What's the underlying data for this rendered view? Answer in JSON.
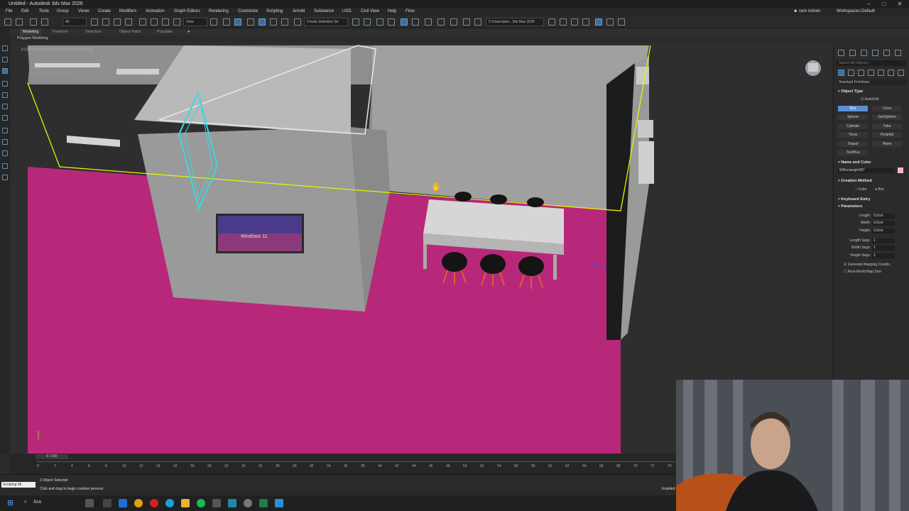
{
  "window": {
    "title": "Untitled - Autodesk 3ds Max 2026",
    "minimize": "–",
    "maximize": "□",
    "close": "✕"
  },
  "menus": [
    "File",
    "Edit",
    "Tools",
    "Group",
    "Views",
    "Create",
    "Modifiers",
    "Animation",
    "Graph Editors",
    "Rendering",
    "Customize",
    "Scripting",
    "Arnold",
    "Substance",
    "USD",
    "Civil View",
    "Help",
    "Flow"
  ],
  "user": {
    "name": "cem isimen",
    "workspaces_label": "Workspaces:",
    "workspace": "Default"
  },
  "toolbar": {
    "filter": "All",
    "view": "View",
    "selection_set": "Create Selection Se",
    "path": "C:\\Users\\pen...3ds Max 2026"
  },
  "ribbon": {
    "tabs": [
      "Modeling",
      "Freeform",
      "Selection",
      "Object Paint",
      "Populate"
    ],
    "active": "Modeling",
    "subtab": "Polygon Modeling"
  },
  "viewport": {
    "label": "[+] [Perspective] [Standard] [Default Shading]",
    "tv_text": "Windows 11"
  },
  "command_panel": {
    "search_placeholder": "Search All Objects...",
    "category": "Standard Primitives",
    "object_type": {
      "title": "Object Type",
      "autogrid": "AutoGrid",
      "buttons": [
        "Box",
        "Cone",
        "Sphere",
        "GeoSphere",
        "Cylinder",
        "Tube",
        "Torus",
        "Pyramid",
        "Teapot",
        "Plane",
        "TextPlus"
      ],
      "selected": "Box"
    },
    "name_and_color": {
      "title": "Name and Color",
      "name": "WRectangle087",
      "color": "#f2b8c6"
    },
    "creation_method": {
      "title": "Creation Method",
      "options": [
        "Cube",
        "Box"
      ],
      "selected": "Box"
    },
    "keyboard_entry": {
      "title": "Keyboard Entry"
    },
    "parameters": {
      "title": "Parameters",
      "fields": [
        {
          "label": "Length:",
          "value": "0,0cm"
        },
        {
          "label": "Width:",
          "value": "0,0cm"
        },
        {
          "label": "Height:",
          "value": "0,0cm"
        },
        {
          "label": "Length Segs:",
          "value": "1"
        },
        {
          "label": "Width Segs:",
          "value": "1"
        },
        {
          "label": "Height Segs:",
          "value": "1"
        }
      ],
      "gen_mapping": "Generate Mapping Coords.",
      "real_world": "Real-World Map Size"
    }
  },
  "timeline": {
    "frame": "0 / 100",
    "ticks": [
      "0",
      "2",
      "4",
      "6",
      "8",
      "10",
      "12",
      "14",
      "16",
      "18",
      "20",
      "22",
      "24",
      "26",
      "28",
      "30",
      "32",
      "34",
      "36",
      "38",
      "40",
      "42",
      "44",
      "46",
      "48",
      "50",
      "52",
      "54",
      "56",
      "58",
      "60",
      "62",
      "64",
      "66",
      "68",
      "70",
      "72",
      "74"
    ]
  },
  "status": {
    "selected": "1 Object Selected",
    "prompt": "Click and drag to begin creation process",
    "script": "Scripting Mi",
    "enabled": "Enabled"
  },
  "taskbar": {
    "search": "Ara"
  },
  "colors": {
    "floor": "#c2277c",
    "selection": "#e8f000",
    "accent": "#5c8fd6"
  }
}
